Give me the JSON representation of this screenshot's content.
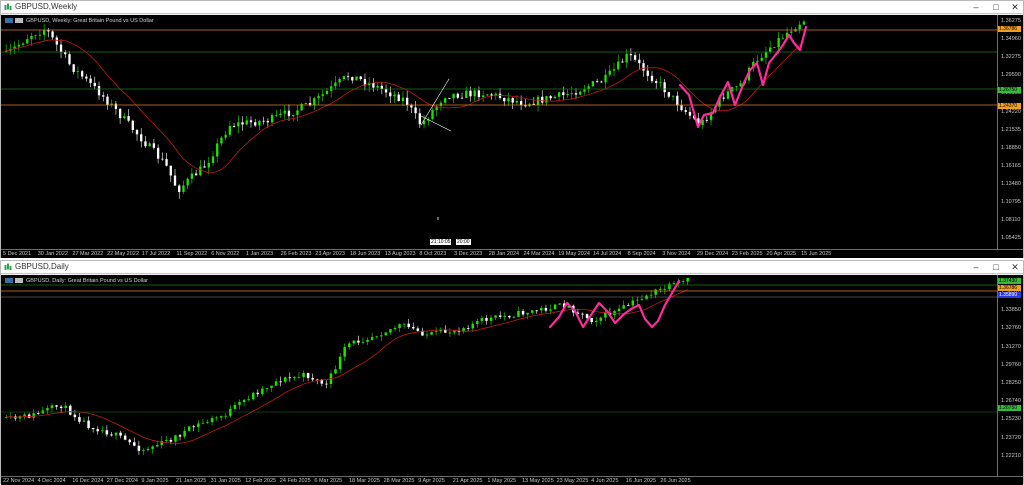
{
  "colors": {
    "bull": "#22e000",
    "bear": "#ffffff",
    "ma": "#c0181c",
    "zigzag": "#ff2a9d",
    "hline_orange": "#e07a2a",
    "hline_green": "#1a7a1a",
    "tag_orange": "#f0a020",
    "tag_green": "#39b83a",
    "tag_blue": "#2a3adc",
    "background": "#000000"
  },
  "weekly": {
    "title": "GBPUSD,Weekly",
    "legend": "GBPUSD, Weekly:  Great Britain Pound vs US Dollar",
    "price_labels": [
      "1.36275",
      "1.34960",
      "1.32275",
      "1.29590",
      "1.26905",
      "1.24220",
      "1.21535",
      "1.18850",
      "1.16165",
      "1.13480",
      "1.10795",
      "1.08110",
      "1.05425"
    ],
    "price_tags": [
      {
        "text": "1.36786",
        "kind": "orange"
      },
      {
        "text": "1.26750",
        "kind": "green"
      },
      {
        "text": "1.24370",
        "kind": "orange"
      }
    ],
    "time_labels": [
      "5 Dec 2021",
      "30 Jan 2022",
      "27 Mar 2022",
      "22 May 2022",
      "17 Jul 2022",
      "11 Sep 2022",
      "6 Nov 2022",
      "1 Jan 2023",
      "26 Feb 2023",
      "23 Apr 2023",
      "18 Jun 2023",
      "13 Aug 2023",
      "8 Oct 2023",
      "3 Dec 2023",
      "28 Jan 2024",
      "24 Mar 2024",
      "19 May 2024",
      "14 Jul 2024",
      "8 Sep 2024",
      "3 Nov 2024",
      "29 Dec 2024",
      "23 Feb 2025",
      "20 Apr 2025",
      "15 Jun 2025"
    ],
    "crosshair_labels": [
      "21:10:05",
      "20:00"
    ]
  },
  "daily": {
    "title": "GBPUSD,Daily",
    "legend": "GBPUSD, Daily:  Great Britain Pound vs US Dollar",
    "price_labels": [
      "1.36370",
      "1.33850",
      "1.32760",
      "1.31270",
      "1.29760",
      "1.28250",
      "1.26740",
      "1.25230",
      "1.23720",
      "1.22210"
    ],
    "price_tags": [
      {
        "text": "1.37430",
        "kind": "green"
      },
      {
        "text": "1.36786",
        "kind": "orange"
      },
      {
        "text": "1.35890",
        "kind": "blue"
      },
      {
        "text": "1.26750",
        "kind": "green"
      }
    ],
    "time_labels": [
      "22 Nov 2024",
      "4 Dec 2024",
      "16 Dec 2024",
      "27 Dec 2024",
      "9 Jan 2025",
      "21 Jan 2025",
      "31 Jan 2025",
      "12 Feb 2025",
      "24 Feb 2025",
      "6 Mar 2025",
      "18 Mar 2025",
      "28 Mar 2025",
      "9 Apr 2025",
      "21 Apr 2025",
      "1 May 2025",
      "13 May 2025",
      "23 May 2025",
      "4 Jun 2025",
      "16 Jun 2025",
      "26 Jun 2025"
    ]
  },
  "window_buttons": {
    "minimize": "–",
    "maximize": "□",
    "close": "✕"
  }
}
